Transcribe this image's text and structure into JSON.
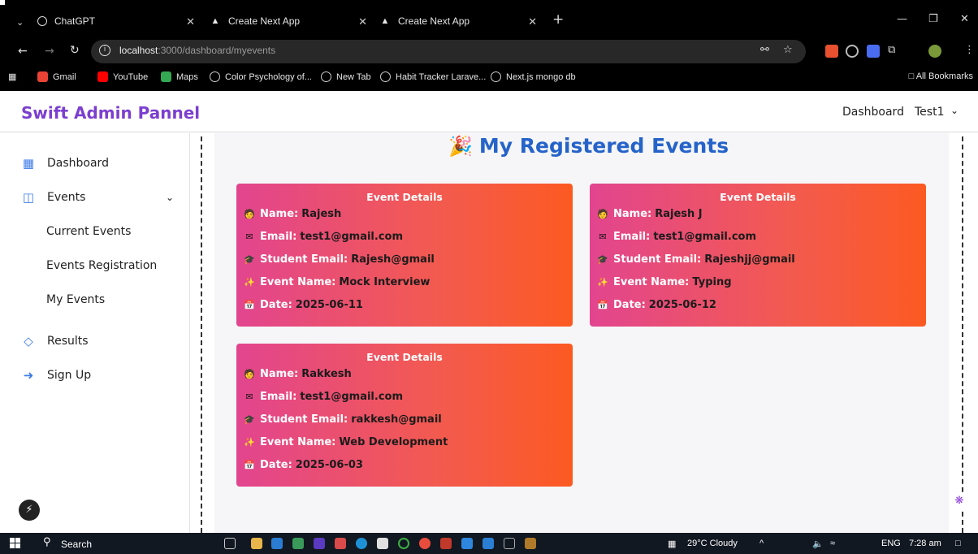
{
  "browser": {
    "tabs": [
      {
        "title": "ChatGPT"
      },
      {
        "title": "Create Next App"
      },
      {
        "title": "Create Next App"
      }
    ],
    "url_host": "localhost",
    "url_path": ":3000/dashboard/myevents",
    "bookmarks": [
      {
        "label": "Gmail",
        "color": "#ea4335"
      },
      {
        "label": "YouTube",
        "color": "#ff0000"
      },
      {
        "label": "Maps",
        "color": "#34a853"
      },
      {
        "label": "Color Psychology of...",
        "color": "#cccccc"
      },
      {
        "label": "New Tab",
        "color": "#cccccc"
      },
      {
        "label": "Habit Tracker Larave...",
        "color": "#cccccc"
      },
      {
        "label": "Next.js mongo db",
        "color": "#cccccc"
      }
    ],
    "all_bookmarks": "All Bookmarks"
  },
  "header": {
    "brand": "Swift Admin Pannel",
    "dashboard_link": "Dashboard",
    "user": "Test1"
  },
  "sidebar": {
    "items": [
      {
        "label": "Dashboard",
        "icon": "dashboard-icon"
      },
      {
        "label": "Events",
        "icon": "events-icon"
      },
      {
        "label": "Results",
        "icon": "diamond-icon"
      },
      {
        "label": "Sign Up",
        "icon": "sign-up-icon"
      }
    ],
    "subitems": [
      {
        "label": "Current Events"
      },
      {
        "label": "Events Registration"
      },
      {
        "label": "My Events"
      }
    ]
  },
  "main": {
    "title": "My Registered Events",
    "labels": {
      "card_title": "Event Details",
      "name": "Name:",
      "email": "Email:",
      "student_email": "Student Email:",
      "event_name": "Event Name:",
      "date": "Date:"
    },
    "cards": [
      {
        "name": "Rajesh",
        "email": "test1@gmail.com",
        "student_email": "Rajesh@gmail",
        "event_name": "Mock Interview",
        "date": "2025-06-11"
      },
      {
        "name": "Rajesh J",
        "email": "test1@gmail.com",
        "student_email": "Rajeshjj@gmail",
        "event_name": "Typing",
        "date": "2025-06-12"
      },
      {
        "name": "Rakkesh",
        "email": "test1@gmail.com",
        "student_email": "rakkesh@gmail",
        "event_name": "Web Development",
        "date": "2025-06-03"
      }
    ],
    "card_gradient": [
      "#e2458f",
      "#fc5a22"
    ]
  },
  "taskbar": {
    "search": "Search",
    "weather": "29°C Cloudy",
    "lang": "ENG",
    "time": "7:28 am"
  },
  "colors": {
    "brand": "#7b3fcf",
    "title": "#2563c9",
    "sidebar_icon": "#3d7be8"
  }
}
